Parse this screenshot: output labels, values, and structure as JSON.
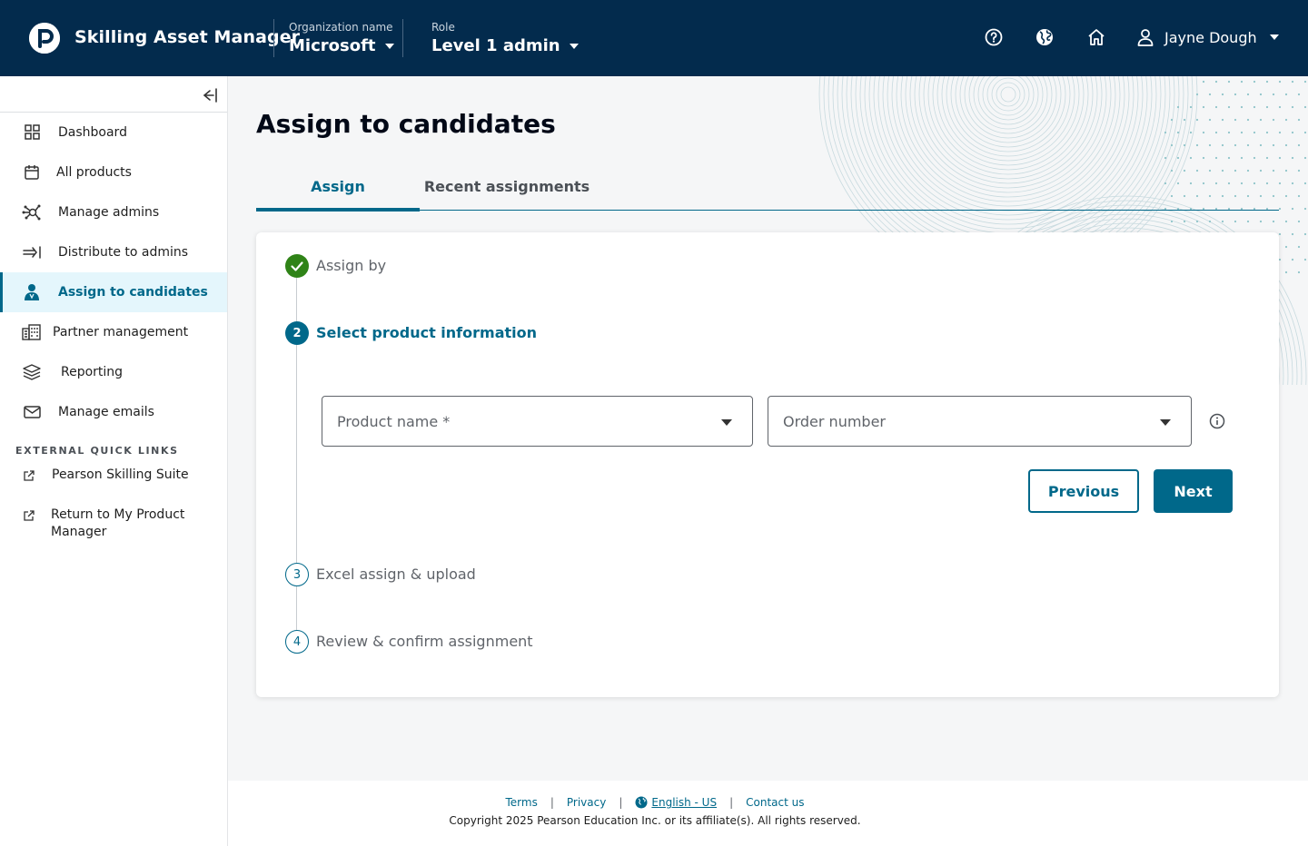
{
  "header": {
    "app_title": "Skilling Asset Manager",
    "org_label": "Organization name",
    "org_value": "Microsoft",
    "role_label": "Role",
    "role_value": "Level 1 admin",
    "user_name": "Jayne Dough"
  },
  "sidebar": {
    "items": [
      {
        "label": "Dashboard",
        "icon": "grid-icon"
      },
      {
        "label": "All products",
        "icon": "box-icon"
      },
      {
        "label": "Manage admins",
        "icon": "network-icon"
      },
      {
        "label": "Distribute to admins",
        "icon": "arrow-right-bar-icon"
      },
      {
        "label": "Assign to candidates",
        "icon": "person-icon",
        "active": true
      },
      {
        "label": "Partner management",
        "icon": "building-icon"
      },
      {
        "label": "Reporting",
        "icon": "layers-icon"
      },
      {
        "label": "Manage emails",
        "icon": "envelope-icon"
      }
    ],
    "external_heading": "EXTERNAL QUICK LINKS",
    "external_links": [
      {
        "label": "Pearson Skilling Suite"
      },
      {
        "label": "Return to My Product Manager"
      }
    ]
  },
  "main": {
    "title": "Assign to candidates",
    "tabs": [
      {
        "label": "Assign",
        "active": true
      },
      {
        "label": "Recent assignments",
        "active": false
      }
    ],
    "steps": [
      {
        "number": "1",
        "label": "Assign by",
        "state": "done"
      },
      {
        "number": "2",
        "label": "Select product information",
        "state": "current"
      },
      {
        "number": "3",
        "label": "Excel assign & upload",
        "state": "todo"
      },
      {
        "number": "4",
        "label": "Review & confirm assignment",
        "state": "todo"
      }
    ],
    "product_placeholder": "Product name *",
    "order_placeholder": "Order number",
    "previous_label": "Previous",
    "next_label": "Next"
  },
  "footer": {
    "terms": "Terms",
    "privacy": "Privacy",
    "language": "English - US",
    "contact": "Contact us",
    "copyright": "Copyright 2025 Pearson Education Inc. or its affiliate(s). All rights reserved."
  },
  "colors": {
    "header_bg": "#032b4d",
    "accent": "#00688a",
    "success": "#2f8317",
    "active_bg": "#e4f6fc"
  }
}
